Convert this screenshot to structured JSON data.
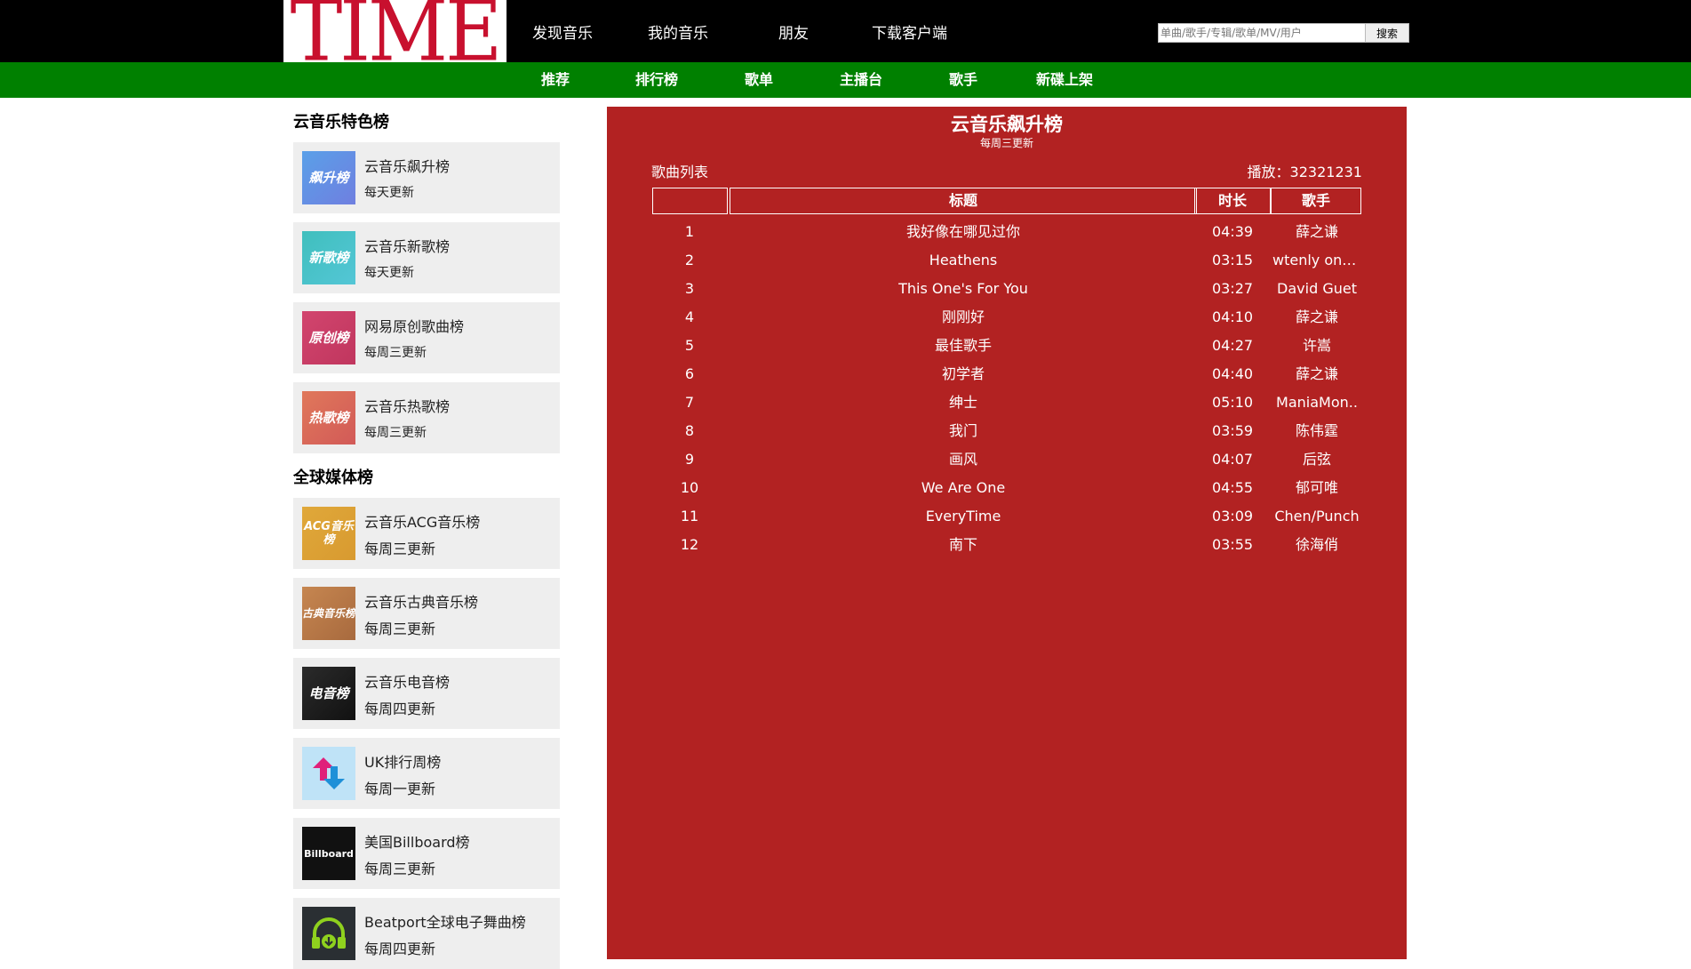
{
  "logo": {
    "text": "TIME"
  },
  "nav": [
    "发现音乐",
    "我的音乐",
    "朋友",
    "下载客户端"
  ],
  "search": {
    "placeholder": "单曲/歌手/专辑/歌单/MV/用户",
    "button": "搜索"
  },
  "subnav": [
    "推荐",
    "排行榜",
    "歌单",
    "主播台",
    "歌手",
    "新碟上架"
  ],
  "sidebar": {
    "section1_title": "云音乐特色榜",
    "section1": [
      {
        "name": "云音乐飙升榜",
        "update": "每天更新",
        "thumb": "飙升榜",
        "icon": "soaring-chart-icon"
      },
      {
        "name": "云音乐新歌榜",
        "update": "每天更新",
        "thumb": "新歌榜",
        "icon": "new-songs-chart-icon"
      },
      {
        "name": "网易原创歌曲榜",
        "update": "每周三更新",
        "thumb": "原创榜",
        "icon": "original-chart-icon"
      },
      {
        "name": "云音乐热歌榜",
        "update": "每周三更新",
        "thumb": "热歌榜",
        "icon": "hot-songs-chart-icon"
      }
    ],
    "section2_title": "全球媒体榜",
    "section2": [
      {
        "name": "云音乐ACG音乐榜",
        "update": "每周三更新",
        "thumb": "ACG音乐榜",
        "icon": "acg-chart-icon"
      },
      {
        "name": "云音乐古典音乐榜",
        "update": "每周三更新",
        "thumb": "古典音乐榜",
        "icon": "classical-chart-icon"
      },
      {
        "name": "云音乐电音榜",
        "update": "每周四更新",
        "thumb": "电音榜",
        "icon": "electronic-chart-icon"
      },
      {
        "name": "UK排行周榜",
        "update": "每周一更新",
        "thumb": "",
        "icon": "uk-chart-arrows-icon"
      },
      {
        "name": "美国Billboard榜",
        "update": "每周三更新",
        "thumb": "Billboard",
        "icon": "billboard-logo-icon"
      },
      {
        "name": "Beatport全球电子舞曲榜",
        "update": "每周四更新",
        "thumb": "",
        "icon": "beatport-headphones-icon"
      }
    ]
  },
  "main": {
    "title": "云音乐飙升榜",
    "subtitle": "每周三更新",
    "list_label": "歌曲列表",
    "play_count": "播放：32321231",
    "headers": {
      "index": "",
      "title": "标题",
      "duration": "时长",
      "artist": "歌手"
    },
    "songs": [
      {
        "index": "1",
        "title": "我好像在哪见过你",
        "duration": "04:39",
        "artist": "薛之谦"
      },
      {
        "index": "2",
        "title": "Heathens",
        "duration": "03:15",
        "artist": "wtenly one..."
      },
      {
        "index": "3",
        "title": "This One's For You",
        "duration": "03:27",
        "artist": "David Guet"
      },
      {
        "index": "4",
        "title": "刚刚好",
        "duration": "04:10",
        "artist": "薛之谦"
      },
      {
        "index": "5",
        "title": "最佳歌手",
        "duration": "04:27",
        "artist": "许嵩"
      },
      {
        "index": "6",
        "title": "初学者",
        "duration": "04:40",
        "artist": "薛之谦"
      },
      {
        "index": "7",
        "title": "绅士",
        "duration": "05:10",
        "artist": "ManiaMon.."
      },
      {
        "index": "8",
        "title": "我门",
        "duration": "03:59",
        "artist": "陈伟霆"
      },
      {
        "index": "9",
        "title": "画风",
        "duration": "04:07",
        "artist": "后弦"
      },
      {
        "index": "10",
        "title": "We Are One",
        "duration": "04:55",
        "artist": "郁可唯"
      },
      {
        "index": "11",
        "title": "EveryTime",
        "duration": "03:09",
        "artist": "Chen/Punch"
      },
      {
        "index": "12",
        "title": "南下",
        "duration": "03:55",
        "artist": "徐海俏"
      }
    ]
  },
  "colors": {
    "topbar": "#000000",
    "subbar": "#008000",
    "panel": "#b22222",
    "logo": "#c8102e",
    "card": "#eeeeee"
  }
}
